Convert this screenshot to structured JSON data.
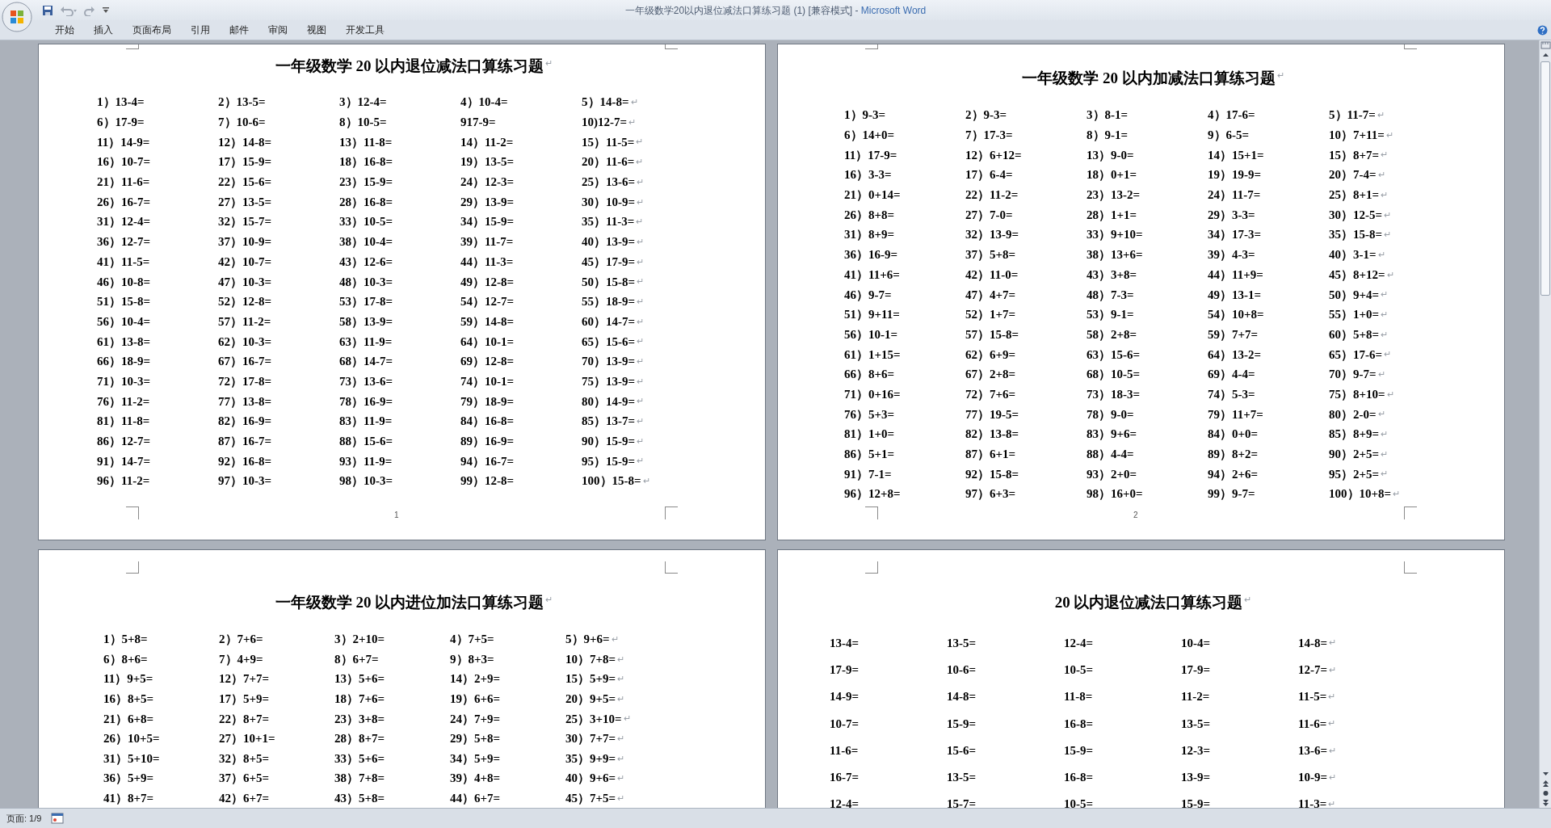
{
  "window": {
    "title": "一年级数学20以内退位减法口算练习题 (1) [兼容模式] -",
    "app_name": "Microsoft Word"
  },
  "ribbon_tabs": [
    "开始",
    "插入",
    "页面布局",
    "引用",
    "邮件",
    "审阅",
    "视图",
    "开发工具"
  ],
  "paragraph_mark": "↵",
  "pages": [
    {
      "title": "一年级数学 20 以内退位减法口算练习题",
      "page_number": "1",
      "problems": [
        "1）13-4=",
        "2）13-5=",
        "3）12-4=",
        "4）10-4=",
        "5）14-8=",
        "6）17-9=",
        "7）10-6=",
        "8）10-5=",
        "917-9=",
        "10)12-7=",
        "11）14-9=",
        "12）14-8=",
        "13）11-8=",
        "14）11-2=",
        "15）11-5=",
        "16）10-7=",
        "17）15-9=",
        "18）16-8=",
        "19）13-5=",
        "20）11-6=",
        "21）11-6=",
        "22）15-6=",
        "23）15-9=",
        "24）12-3=",
        "25）13-6=",
        "26）16-7=",
        "27）13-5=",
        "28）16-8=",
        "29）13-9=",
        "30）10-9=",
        "31）12-4=",
        "32）15-7=",
        "33）10-5=",
        "34）15-9=",
        "35）11-3=",
        "36）12-7=",
        "37）10-9=",
        "38）10-4=",
        "39）11-7=",
        "40）13-9=",
        "41）11-5=",
        "42）10-7=",
        "43）12-6=",
        "44）11-3=",
        "45）17-9=",
        "46）10-8=",
        "47）10-3=",
        "48）10-3=",
        "49）12-8=",
        "50）15-8=",
        "51）15-8=",
        "52）12-8=",
        "53）17-8=",
        "54）12-7=",
        "55）18-9=",
        "56）10-4=",
        "57）11-2=",
        "58）13-9=",
        "59）14-8=",
        "60）14-7=",
        "61）13-8=",
        "62）10-3=",
        "63）11-9=",
        "64）10-1=",
        "65）15-6=",
        "66）18-9=",
        "67）16-7=",
        "68）14-7=",
        "69）12-8=",
        "70）13-9=",
        "71）10-3=",
        "72）17-8=",
        "73）13-6=",
        "74）10-1=",
        "75）13-9=",
        "76）11-2=",
        "77）13-8=",
        "78）16-9=",
        "79）18-9=",
        "80）14-9=",
        "81）11-8=",
        "82）16-9=",
        "83）11-9=",
        "84）16-8=",
        "85）13-7=",
        "86）12-7=",
        "87）16-7=",
        "88）15-6=",
        "89）16-9=",
        "90）15-9=",
        "91）14-7=",
        "92）16-8=",
        "93）11-9=",
        "94）16-7=",
        "95）15-9=",
        "96）11-2=",
        "97）10-3=",
        "98）10-3=",
        "99）12-8=",
        "100）15-8="
      ]
    },
    {
      "title": "一年级数学 20 以内加减法口算练习题",
      "page_number": "2",
      "problems": [
        "1）9-3=",
        "2）9-3=",
        "3）8-1=",
        "4）17-6=",
        "5）11-7=",
        "6）14+0=",
        "7）17-3=",
        "8）9-1=",
        "9）6-5=",
        "10）7+11=",
        "11）17-9=",
        "12）6+12=",
        "13）9-0=",
        "14）15+1=",
        "15）8+7=",
        "16）3-3=",
        "17）6-4=",
        "18）0+1=",
        "19）19-9=",
        "20）7-4=",
        "21）0+14=",
        "22）11-2=",
        "23）13-2=",
        "24）11-7=",
        "25）8+1=",
        "26）8+8=",
        "27）7-0=",
        "28）1+1=",
        "29）3-3=",
        "30）12-5=",
        "31）8+9=",
        "32）13-9=",
        "33）9+10=",
        "34）17-3=",
        "35）15-8=",
        "36）16-9=",
        "37）5+8=",
        "38）13+6=",
        "39）4-3=",
        "40）3-1=",
        "41）11+6=",
        "42）11-0=",
        "43）3+8=",
        "44）11+9=",
        "45）8+12=",
        "46）9-7=",
        "47）4+7=",
        "48）7-3=",
        "49）13-1=",
        "50）9+4=",
        "51）9+11=",
        "52）1+7=",
        "53）9-1=",
        "54）10+8=",
        "55）1+0=",
        "56）10-1=",
        "57）15-8=",
        "58）2+8=",
        "59）7+7=",
        "60）5+8=",
        "61）1+15=",
        "62）6+9=",
        "63）15-6=",
        "64）13-2=",
        "65）17-6=",
        "66）8+6=",
        "67）2+8=",
        "68）10-5=",
        "69）4-4=",
        "70）9-7=",
        "71）0+16=",
        "72）7+6=",
        "73）18-3=",
        "74）5-3=",
        "75）8+10=",
        "76）5+3=",
        "77）19-5=",
        "78）9-0=",
        "79）11+7=",
        "80）2-0=",
        "81）1+0=",
        "82）13-8=",
        "83）9+6=",
        "84）0+0=",
        "85）8+9=",
        "86）5+1=",
        "87）6+1=",
        "88）4-4=",
        "89）8+2=",
        "90）2+5=",
        "91）7-1=",
        "92）15-8=",
        "93）2+0=",
        "94）2+6=",
        "95）2+5=",
        "96）12+8=",
        "97）6+3=",
        "98）16+0=",
        "99）9-7=",
        "100）10+8="
      ]
    },
    {
      "title": "一年级数学 20 以内进位加法口算练习题",
      "problems": [
        "1）5+8=",
        "2）7+6=",
        "3）2+10=",
        "4）7+5=",
        "5）9+6=",
        "6）8+6=",
        "7）4+9=",
        "8）6+7=",
        "9）8+3=",
        "10）7+8=",
        "11）9+5=",
        "12）7+7=",
        "13）5+6=",
        "14）2+9=",
        "15）5+9=",
        "16）8+5=",
        "17）5+9=",
        "18）7+6=",
        "19）6+6=",
        "20）9+5=",
        "21）6+8=",
        "22）8+7=",
        "23）3+8=",
        "24）7+9=",
        "25）3+10=",
        "26）10+5=",
        "27）10+1=",
        "28）8+7=",
        "29）5+8=",
        "30）7+7=",
        "31）5+10=",
        "32）8+5=",
        "33）5+6=",
        "34）5+9=",
        "35）9+9=",
        "36）5+9=",
        "37）6+5=",
        "38）7+8=",
        "39）4+8=",
        "40）9+6=",
        "41）8+7=",
        "42）6+7=",
        "43）5+8=",
        "44）6+7=",
        "45）7+5="
      ]
    },
    {
      "title": "20 以内退位减法口算练习题",
      "problems": [
        "13-4=",
        "13-5=",
        "12-4=",
        "10-4=",
        "14-8=",
        "17-9=",
        "10-6=",
        "10-5=",
        "17-9=",
        "12-7=",
        "14-9=",
        "14-8=",
        "11-8=",
        "11-2=",
        "11-5=",
        "10-7=",
        "15-9=",
        "16-8=",
        "13-5=",
        "11-6=",
        "11-6=",
        "15-6=",
        "15-9=",
        "12-3=",
        "13-6=",
        "16-7=",
        "13-5=",
        "16-8=",
        "13-9=",
        "10-9=",
        "12-4=",
        "15-7=",
        "10-5=",
        "15-9=",
        "11-3="
      ]
    }
  ],
  "status_bar": {
    "page": "页面: 1/9"
  }
}
